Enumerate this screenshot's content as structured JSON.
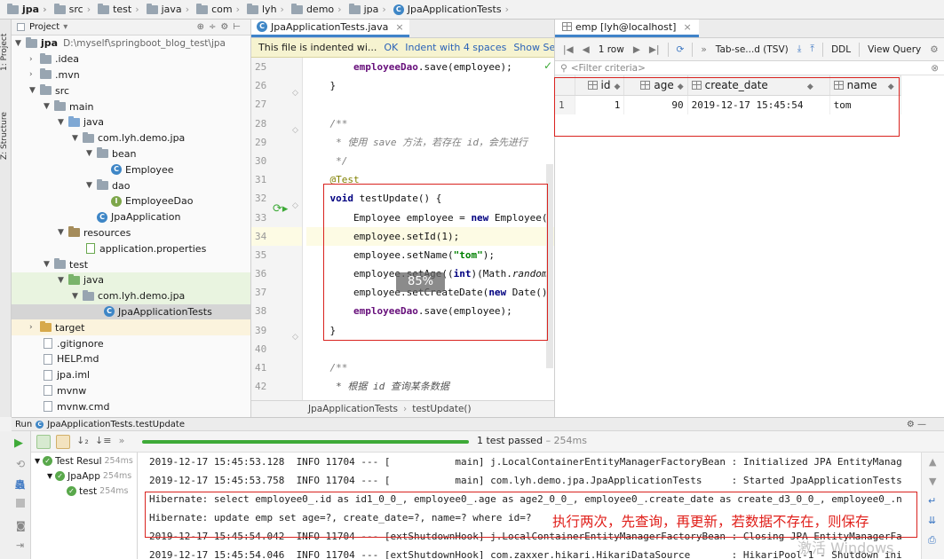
{
  "breadcrumb": [
    "jpa",
    "src",
    "test",
    "java",
    "com",
    "lyh",
    "demo",
    "jpa",
    "JpaApplicationTests"
  ],
  "left_strip": {
    "project_tab": "1: Project",
    "structure_tab": "Z: Structure"
  },
  "project": {
    "title": "Project",
    "root_name": "jpa",
    "root_path": "D:\\myself\\springboot_blog_test\\jpa",
    "items": [
      ".idea",
      ".mvn",
      "src",
      "main",
      "java",
      "com.lyh.demo.jpa",
      "bean",
      "Employee",
      "dao",
      "EmployeeDao",
      "JpaApplication",
      "resources",
      "application.properties",
      "test",
      "java",
      "com.lyh.demo.jpa",
      "JpaApplicationTests",
      "target",
      ".gitignore",
      "HELP.md",
      "jpa.iml",
      "mvnw",
      "mvnw.cmd"
    ]
  },
  "editor": {
    "tab": "JpaApplicationTests.java",
    "notice": "This file is indented wi...",
    "notice_ok": "OK",
    "notice_indent": "Indent with 4 spaces",
    "notice_settings": "Show Settings",
    "line_numbers": [
      "25",
      "26",
      "27",
      "28",
      "29",
      "30",
      "31",
      "32",
      "33",
      "34",
      "35",
      "36",
      "37",
      "38",
      "39",
      "40",
      "41",
      "42"
    ],
    "zoom": "85%",
    "crumb_file": "JpaApplicationTests",
    "crumb_method": "testUpdate()"
  },
  "db": {
    "tab": "emp [lyh@localhost]",
    "row_count": "1 row",
    "format": "Tab-se...d (TSV)",
    "ddl": "DDL",
    "view_query": "View Query",
    "filter": "<Filter criteria>",
    "columns": [
      "id",
      "age",
      "create_date",
      "name"
    ],
    "rows": [
      {
        "row_no": "1",
        "id": "1",
        "age": "90",
        "create_date": "2019-12-17 15:45:54",
        "name": "tom"
      }
    ]
  },
  "run": {
    "header": "JpaApplicationTests.testUpdate",
    "run_label": "Run",
    "status": "1 test passed",
    "status_time": "– 254ms",
    "tree": [
      {
        "label": "Test Resul",
        "dur": "254ms"
      },
      {
        "label": "JpaApp",
        "dur": "254ms"
      },
      {
        "label": "test",
        "dur": "254ms"
      }
    ],
    "console": [
      "2019-12-17 15:45:53.128  INFO 11704 --- [           main] j.LocalContainerEntityManagerFactoryBean : Initialized JPA EntityManag",
      "2019-12-17 15:45:53.758  INFO 11704 --- [           main] com.lyh.demo.jpa.JpaApplicationTests     : Started JpaApplicationTests",
      "Hibernate: select employee0_.id as id1_0_0_, employee0_.age as age2_0_0_, employee0_.create_date as create_d3_0_0_, employee0_.n",
      "Hibernate: update emp set age=?, create_date=?, name=? where id=?",
      "2019-12-17 15:45:54.042  INFO 11704 --- [extShutdownHook] j.LocalContainerEntityManagerFactoryBean : Closing JPA EntityManagerFa",
      "2019-12-17 15:45:54.046  INFO 11704 --- [extShutdownHook] com.zaxxer.hikari.HikariDataSource       : HikariPool-1 - Shutdown ini"
    ],
    "annotation": "执行两次，先查询，再更新，若数据不存在，则保存",
    "watermark": "激活 Windows"
  },
  "colors": {
    "highlight_box": "#d9231f",
    "pass_green": "#3eaa38",
    "keyword": "#000080",
    "field": "#660e7a",
    "string": "#008000"
  }
}
